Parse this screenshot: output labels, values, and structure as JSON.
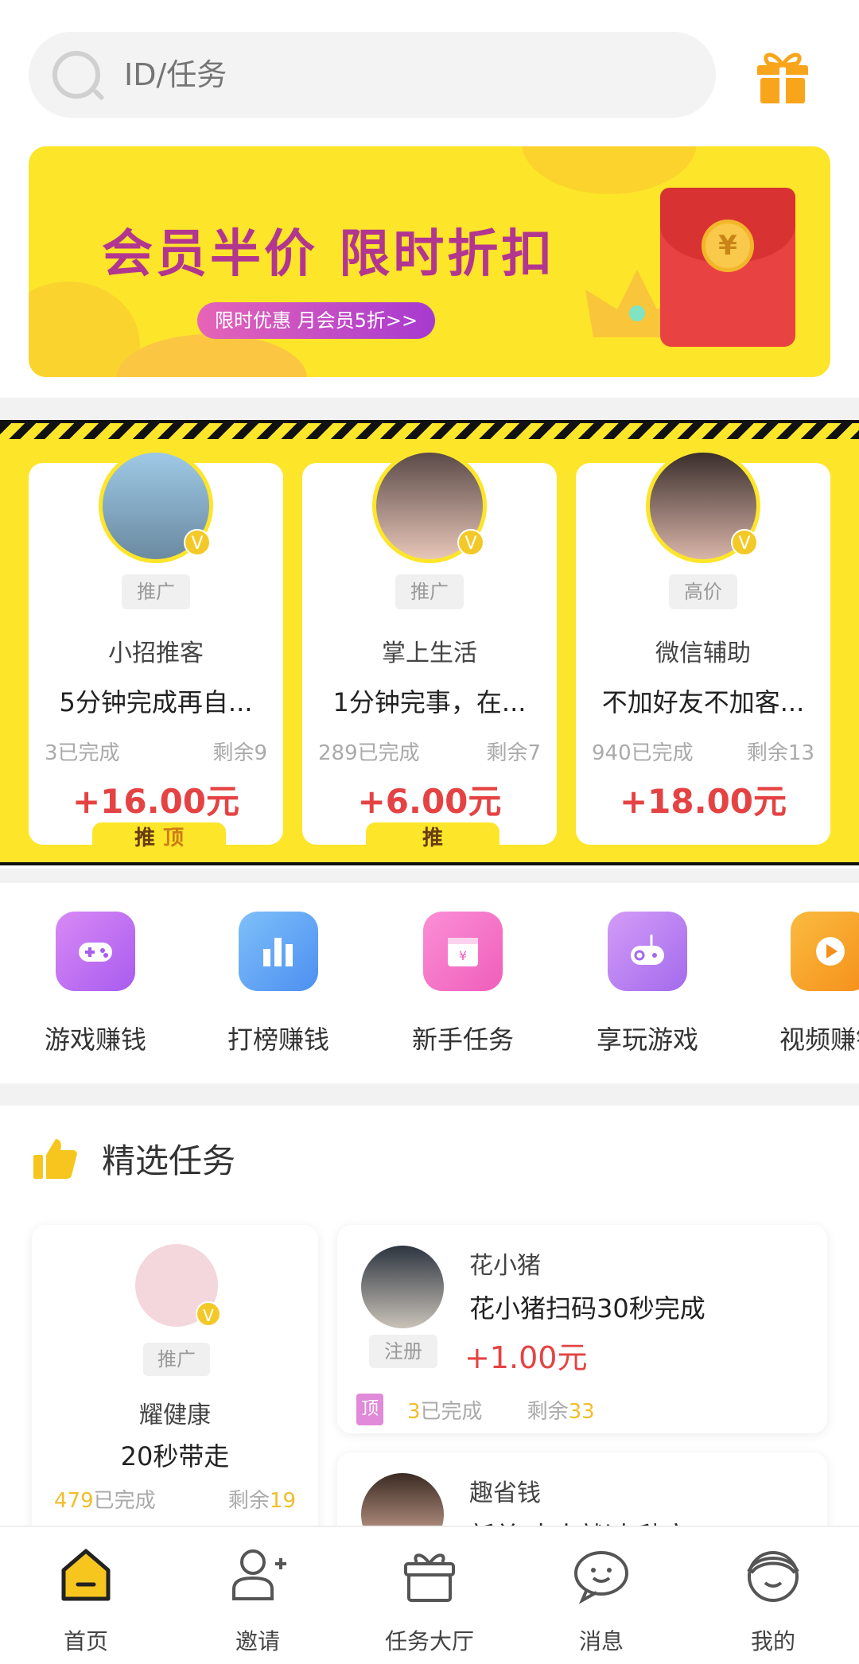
{
  "search": {
    "placeholder": "ID/任务"
  },
  "banner": {
    "title": "会员半价 限时折扣",
    "pill": "限时优惠 月会员5折>>",
    "coin": "¥",
    "colors": {
      "bg": "#fde52a",
      "title": "#b2368f",
      "redpack": "#e94242"
    }
  },
  "top_tasks": [
    {
      "tag": "推广",
      "name": "小招推客",
      "desc": "5分钟完成再自...",
      "completed": "3已完成",
      "remaining": "剩余9",
      "reward": "+16.00元",
      "ribbon": "推",
      "ribbon_extra": "顶",
      "badge": "V"
    },
    {
      "tag": "推广",
      "name": "掌上生活",
      "desc": "1分钟完事，在...",
      "completed": "289已完成",
      "remaining": "剩余7",
      "reward": "+6.00元",
      "ribbon": "推",
      "ribbon_extra": "",
      "badge": "V"
    },
    {
      "tag": "高价",
      "name": "微信辅助",
      "desc": "不加好友不加客...",
      "completed": "940已完成",
      "remaining": "剩余13",
      "reward": "+18.00元",
      "badge": "V"
    }
  ],
  "categories": [
    {
      "label": "游戏赚钱",
      "icon": "gamepad-icon",
      "color": "#c06ef0"
    },
    {
      "label": "打榜赚钱",
      "icon": "bar-chart-icon",
      "color": "#5ea8f5"
    },
    {
      "label": "新手任务",
      "icon": "wallet-icon",
      "color": "#f476c8"
    },
    {
      "label": "享玩游戏",
      "icon": "joystick-icon",
      "color": "#bd7af0"
    },
    {
      "label": "视频赚钱",
      "icon": "video-icon",
      "color": "#f8a428"
    }
  ],
  "selected": {
    "title": "精选任务",
    "feature": {
      "tag": "推广",
      "name": "耀健康",
      "desc": "20秒带走",
      "completed_num": "479",
      "completed_suffix": "已完成",
      "remaining_prefix": "剩余",
      "remaining_num": "19",
      "badge": "V"
    },
    "list": [
      {
        "name": "花小猪",
        "desc": "花小猪扫码30秒完成",
        "tag": "注册",
        "reward": "+1.00元",
        "top_badge": "顶",
        "completed_num": "3",
        "completed_suffix": "已完成",
        "remaining_prefix": "剩余",
        "remaining_num": "33"
      },
      {
        "name": "趣省钱",
        "desc": "新单 来人就过 秒审❤"
      }
    ]
  },
  "nav": [
    {
      "label": "首页",
      "icon": "home-icon",
      "active": true
    },
    {
      "label": "邀请",
      "icon": "invite-user-icon"
    },
    {
      "label": "任务大厅",
      "icon": "task-hall-icon"
    },
    {
      "label": "消息",
      "icon": "message-icon"
    },
    {
      "label": "我的",
      "icon": "profile-icon"
    }
  ]
}
